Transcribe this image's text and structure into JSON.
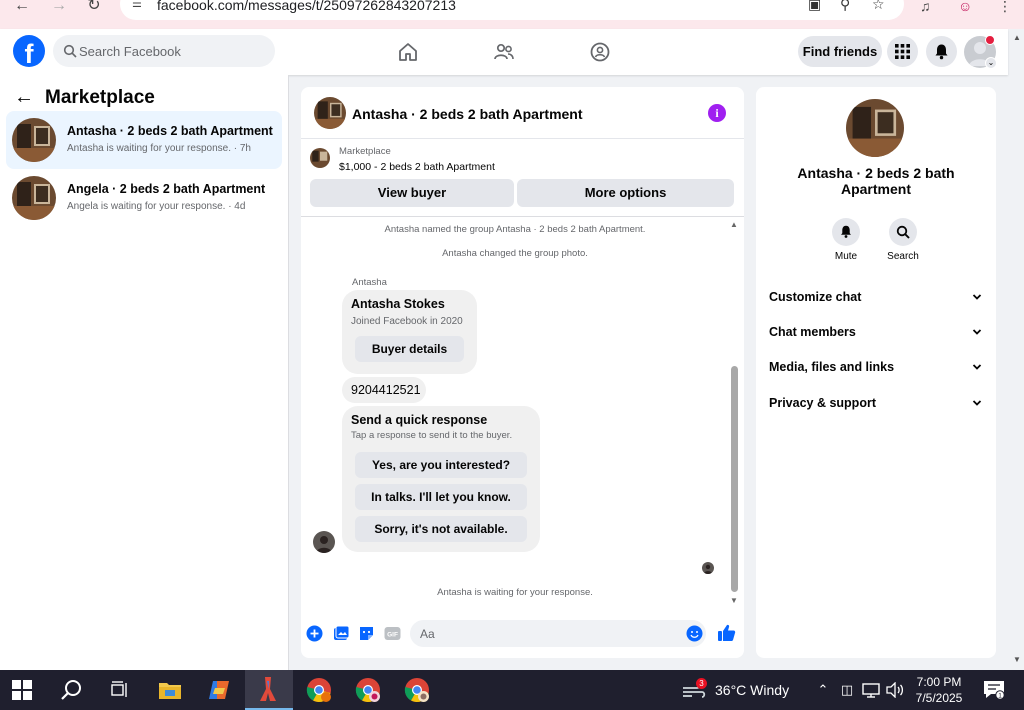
{
  "browser": {
    "url": "facebook.com/messages/t/25097262843207213"
  },
  "topbar": {
    "search_placeholder": "Search Facebook",
    "find_friends": "Find friends",
    "brand_color": "#0866ff"
  },
  "left_panel": {
    "title": "Marketplace",
    "conversations": [
      {
        "title": "Antasha · 2 beds 2 bath Apartment",
        "subtitle": "Antasha is waiting for your response. · 7h",
        "active": true
      },
      {
        "title": "Angela · 2 beds 2 bath Apartment",
        "subtitle": "Angela is waiting for your response. · 4d",
        "active": false
      }
    ]
  },
  "chat": {
    "header_title": "Antasha · 2 beds 2 bath Apartment",
    "marketplace_label": "Marketplace",
    "listing": "$1,000 - 2 beds 2 bath Apartment",
    "view_buyer": "View buyer",
    "more_options": "More options",
    "system_messages": [
      "Antasha named the group Antasha · 2 beds 2 bath Apartment.",
      "Antasha changed the group photo."
    ],
    "sender_name": "Antasha",
    "buyer_card": {
      "name": "Antasha Stokes",
      "joined": "Joined Facebook in 2020",
      "button": "Buyer details"
    },
    "phone_message": "9204412521",
    "quick_response": {
      "title": "Send a quick response",
      "subtitle": "Tap a response to send it to the buyer.",
      "options": [
        "Yes, are you interested?",
        "In talks. I'll let you know.",
        "Sorry, it's not available."
      ]
    },
    "waiting_text": "Antasha is waiting for your response.",
    "composer_placeholder": "Aa"
  },
  "right_panel": {
    "title": "Antasha · 2 beds 2 bath Apartment",
    "actions": [
      "Mute",
      "Search"
    ],
    "sections": [
      "Customize chat",
      "Chat members",
      "Media, files and links",
      "Privacy & support"
    ]
  },
  "taskbar": {
    "weather_badge": "3",
    "weather": "36°C  Windy",
    "time": "7:00 PM",
    "date": "7/5/2025",
    "notification_count": "1"
  }
}
